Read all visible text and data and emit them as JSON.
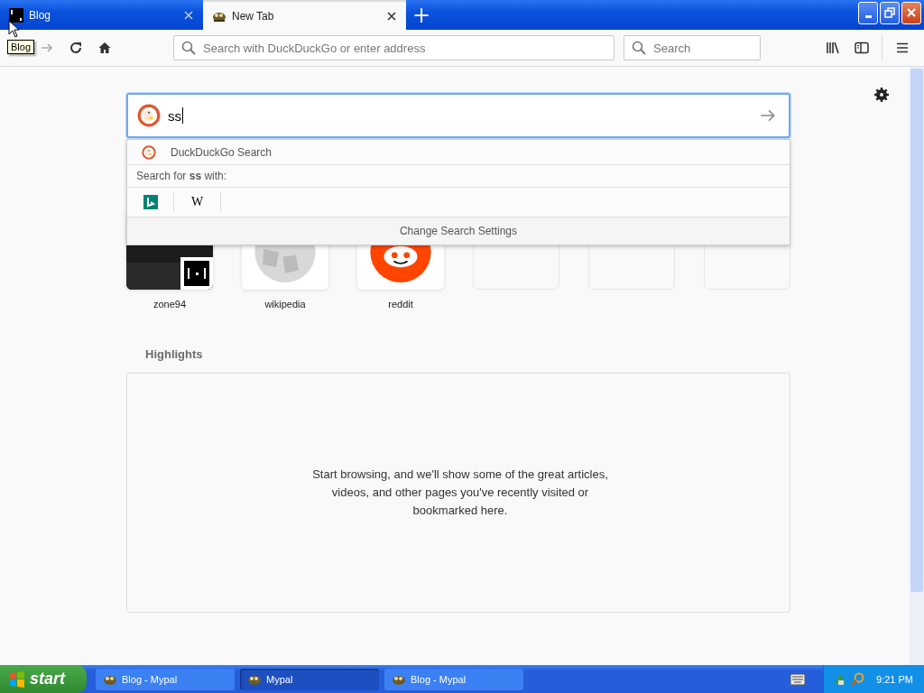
{
  "tabs": [
    {
      "title": "Blog",
      "kind": "square",
      "selected": false
    },
    {
      "title": "New Tab",
      "kind": "mascot",
      "selected": true
    }
  ],
  "new_tab_button": "+",
  "tooltip": "Blog",
  "address_bar": {
    "placeholder": "Search with DuckDuckGo or enter address"
  },
  "search_bar": {
    "placeholder": "Search"
  },
  "page_search": {
    "value": "ss"
  },
  "dropdown": {
    "engine": "DuckDuckGo Search",
    "search_for": "Search for **ss** with:",
    "one_offs": [
      {
        "kind": "bing"
      },
      {
        "kind": "wikipedia",
        "glyph": "W"
      }
    ],
    "settings": "Change Search Settings"
  },
  "top_sites": [
    {
      "kind": "screenshot",
      "label": "zone94"
    },
    {
      "kind": "wikipedia",
      "label": "wikipedia"
    },
    {
      "kind": "reddit",
      "label": "reddit"
    },
    {
      "kind": "empty"
    },
    {
      "kind": "empty"
    },
    {
      "kind": "empty"
    }
  ],
  "highlights": {
    "title": "Highlights",
    "message": "Start browsing, and we'll show some of the great articles, videos, and other pages you've recently visited or bookmarked here."
  },
  "taskbar": {
    "start": "start",
    "items": [
      {
        "label": "Blog - Mypal",
        "selected": false
      },
      {
        "label": "Mypal",
        "selected": true
      },
      {
        "label": "Blog - Mypal",
        "selected": false
      }
    ],
    "clock": "9:21 PM"
  }
}
